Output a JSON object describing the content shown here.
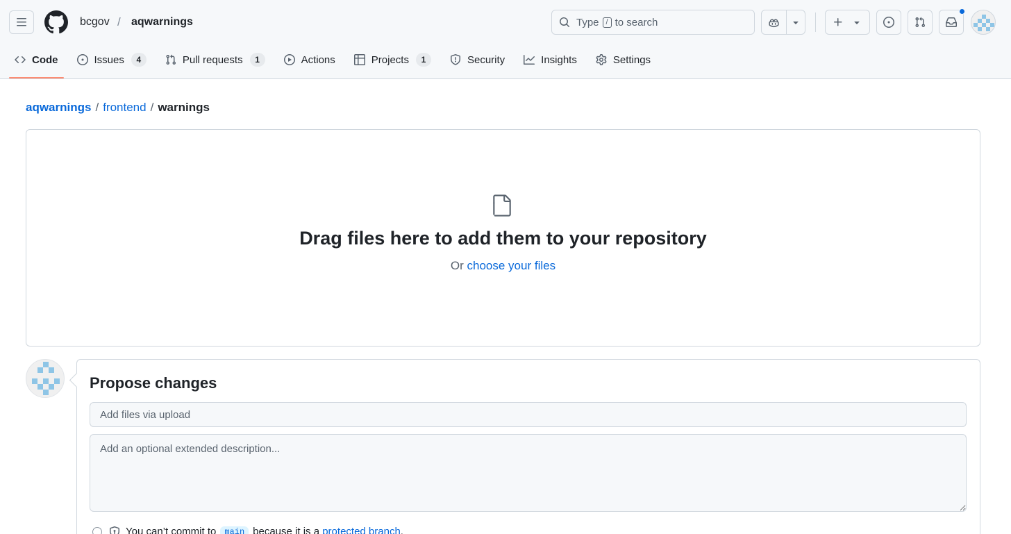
{
  "header": {
    "owner": "bcgov",
    "separator": "/",
    "repo": "aqwarnings",
    "search": {
      "before": "Type",
      "key": "/",
      "after": "to search"
    }
  },
  "tabs": [
    {
      "label": "Code",
      "icon": "code-icon",
      "selected": true
    },
    {
      "label": "Issues",
      "icon": "issue-opened-icon",
      "count": "4"
    },
    {
      "label": "Pull requests",
      "icon": "git-pull-request-icon",
      "count": "1"
    },
    {
      "label": "Actions",
      "icon": "play-icon"
    },
    {
      "label": "Projects",
      "icon": "table-icon",
      "count": "1"
    },
    {
      "label": "Security",
      "icon": "shield-icon"
    },
    {
      "label": "Insights",
      "icon": "graph-icon"
    },
    {
      "label": "Settings",
      "icon": "gear-icon"
    }
  ],
  "path": {
    "repo": "aqwarnings",
    "folder": "frontend",
    "current": "warnings",
    "sep": "/"
  },
  "dropzone": {
    "title": "Drag files here to add them to your repository",
    "or_text": "Or",
    "choose_link": "choose your files"
  },
  "commit": {
    "title": "Propose changes",
    "summary_placeholder": "Add files via upload",
    "description_placeholder": "Add an optional extended description...",
    "protected_prefix": "You can’t commit to",
    "branch": "main",
    "protected_middle": "because it is a",
    "protected_link": "protected branch",
    "protected_suffix": "."
  },
  "colors": {
    "accent": "#0969da",
    "tab_underline": "#fd8c73",
    "avatar_blue": "#8ec5e6"
  }
}
